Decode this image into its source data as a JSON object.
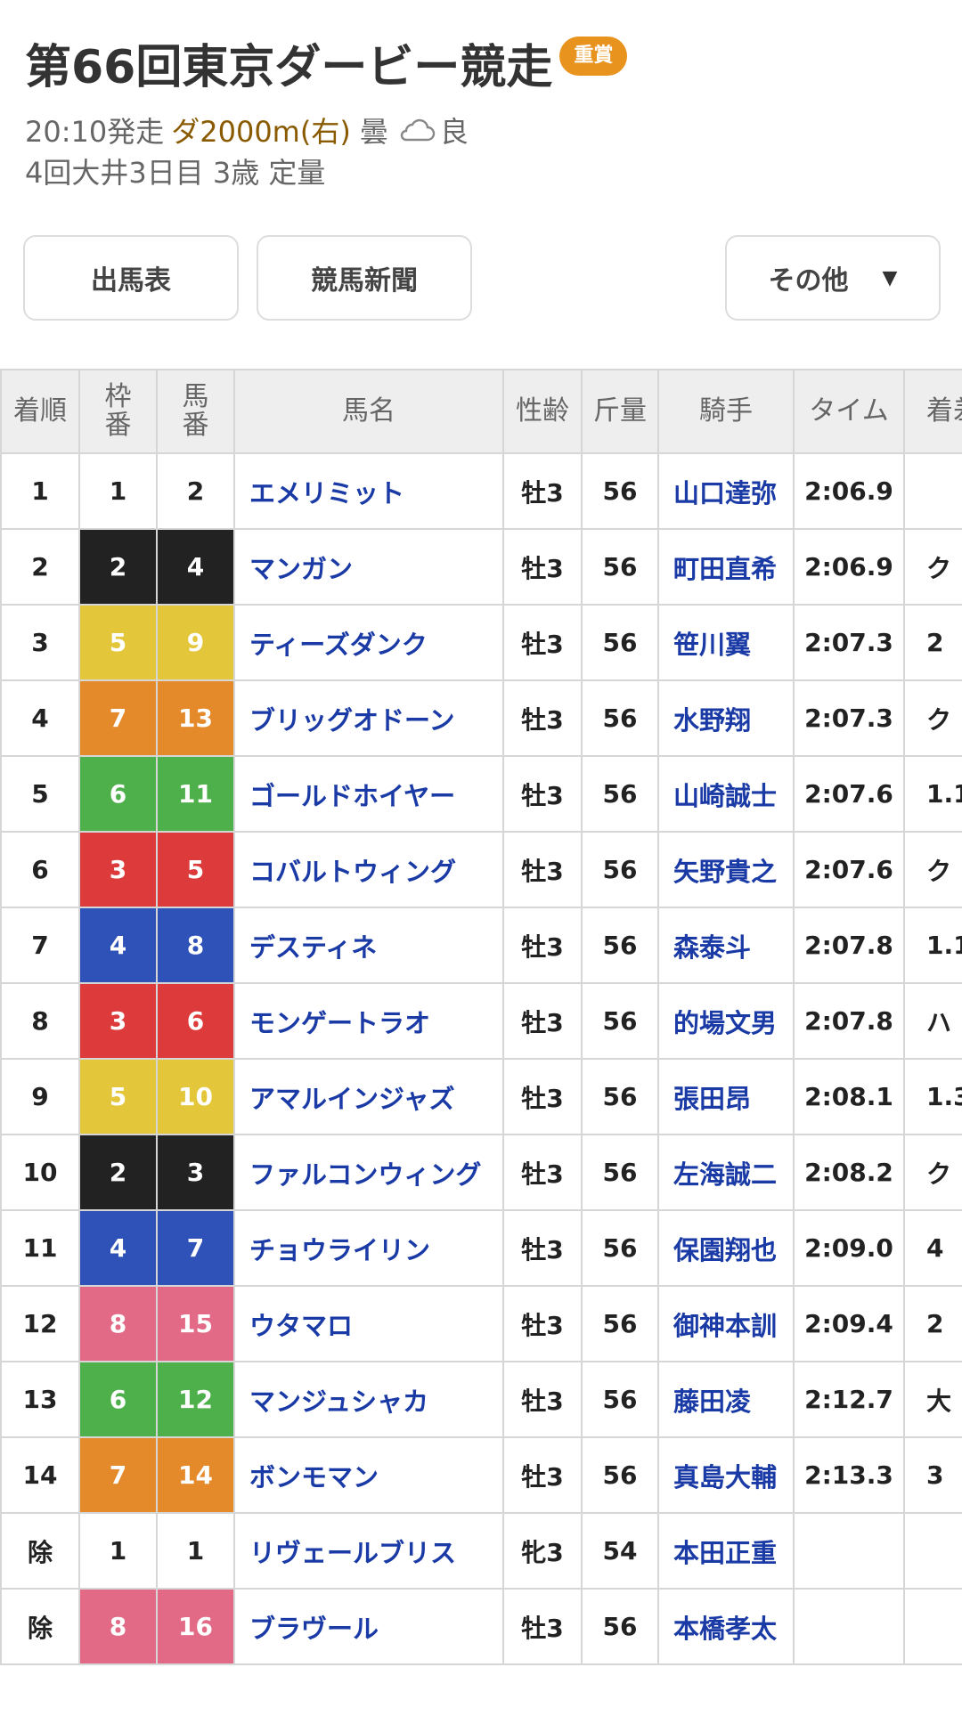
{
  "race": {
    "title": "第66回東京ダービー競走",
    "grade": "重賞",
    "start": "20:10発走",
    "course": "ダ2000m(右)",
    "weather": "曇",
    "track": "良",
    "meeting": "4回大井3日目 3歳 定量"
  },
  "buttons": {
    "shutuba": "出馬表",
    "shinbun": "競馬新聞",
    "other": "その他",
    "other_caret": "▼"
  },
  "table": {
    "headers": {
      "rank": "着順",
      "frame_top": "枠",
      "frame_bottom": "番",
      "num_top": "馬",
      "num_bottom": "番",
      "name": "馬名",
      "sexage": "性齢",
      "weight": "斤量",
      "jockey": "騎手",
      "time": "タイム",
      "margin": "着差"
    },
    "rows": [
      {
        "rank": "1",
        "frame": "1",
        "num": "2",
        "name": "エメリミット",
        "sexage": "牡3",
        "weight": "56",
        "jockey": "山口達弥",
        "time": "2:06.9",
        "margin": ""
      },
      {
        "rank": "2",
        "frame": "2",
        "num": "4",
        "name": "マンガン",
        "sexage": "牡3",
        "weight": "56",
        "jockey": "町田直希",
        "time": "2:06.9",
        "margin": "ク"
      },
      {
        "rank": "3",
        "frame": "5",
        "num": "9",
        "name": "ティーズダンク",
        "sexage": "牡3",
        "weight": "56",
        "jockey": "笹川翼",
        "time": "2:07.3",
        "margin": "2"
      },
      {
        "rank": "4",
        "frame": "7",
        "num": "13",
        "name": "ブリッグオドーン",
        "sexage": "牡3",
        "weight": "56",
        "jockey": "水野翔",
        "time": "2:07.3",
        "margin": "ク"
      },
      {
        "rank": "5",
        "frame": "6",
        "num": "11",
        "name": "ゴールドホイヤー",
        "sexage": "牡3",
        "weight": "56",
        "jockey": "山崎誠士",
        "time": "2:07.6",
        "margin": "1.1"
      },
      {
        "rank": "6",
        "frame": "3",
        "num": "5",
        "name": "コバルトウィング",
        "sexage": "牡3",
        "weight": "56",
        "jockey": "矢野貴之",
        "time": "2:07.6",
        "margin": "ク"
      },
      {
        "rank": "7",
        "frame": "4",
        "num": "8",
        "name": "デスティネ",
        "sexage": "牡3",
        "weight": "56",
        "jockey": "森泰斗",
        "time": "2:07.8",
        "margin": "1.1"
      },
      {
        "rank": "8",
        "frame": "3",
        "num": "6",
        "name": "モンゲートラオ",
        "sexage": "牡3",
        "weight": "56",
        "jockey": "的場文男",
        "time": "2:07.8",
        "margin": "ハ"
      },
      {
        "rank": "9",
        "frame": "5",
        "num": "10",
        "name": "アマルインジャズ",
        "sexage": "牡3",
        "weight": "56",
        "jockey": "張田昂",
        "time": "2:08.1",
        "margin": "1.3"
      },
      {
        "rank": "10",
        "frame": "2",
        "num": "3",
        "name": "ファルコンウィング",
        "sexage": "牡3",
        "weight": "56",
        "jockey": "左海誠二",
        "time": "2:08.2",
        "margin": "ク"
      },
      {
        "rank": "11",
        "frame": "4",
        "num": "7",
        "name": "チョウライリン",
        "sexage": "牡3",
        "weight": "56",
        "jockey": "保園翔也",
        "time": "2:09.0",
        "margin": "4"
      },
      {
        "rank": "12",
        "frame": "8",
        "num": "15",
        "name": "ウタマロ",
        "sexage": "牡3",
        "weight": "56",
        "jockey": "御神本訓",
        "time": "2:09.4",
        "margin": "2"
      },
      {
        "rank": "13",
        "frame": "6",
        "num": "12",
        "name": "マンジュシャカ",
        "sexage": "牡3",
        "weight": "56",
        "jockey": "藤田凌",
        "time": "2:12.7",
        "margin": "大"
      },
      {
        "rank": "14",
        "frame": "7",
        "num": "14",
        "name": "ボンモマン",
        "sexage": "牡3",
        "weight": "56",
        "jockey": "真島大輔",
        "time": "2:13.3",
        "margin": "3"
      },
      {
        "rank": "除",
        "frame": "1",
        "num": "1",
        "name": "リヴェールブリス",
        "sexage": "牝3",
        "weight": "54",
        "jockey": "本田正重",
        "time": "",
        "margin": ""
      },
      {
        "rank": "除",
        "frame": "8",
        "num": "16",
        "name": "ブラヴール",
        "sexage": "牡3",
        "weight": "56",
        "jockey": "本橋孝太",
        "time": "",
        "margin": ""
      }
    ]
  },
  "colors": {
    "frame_1": "#ffffff",
    "frame_2": "#222222",
    "frame_3": "#dd3b3b",
    "frame_4": "#2f52b8",
    "frame_5": "#e4c63a",
    "frame_6": "#4db04a",
    "frame_7": "#e58a2b",
    "frame_8": "#e26a86",
    "grade_badge": "#e8931e",
    "link": "#1a3aa6"
  },
  "icons": {
    "weather": "cloud-icon"
  }
}
